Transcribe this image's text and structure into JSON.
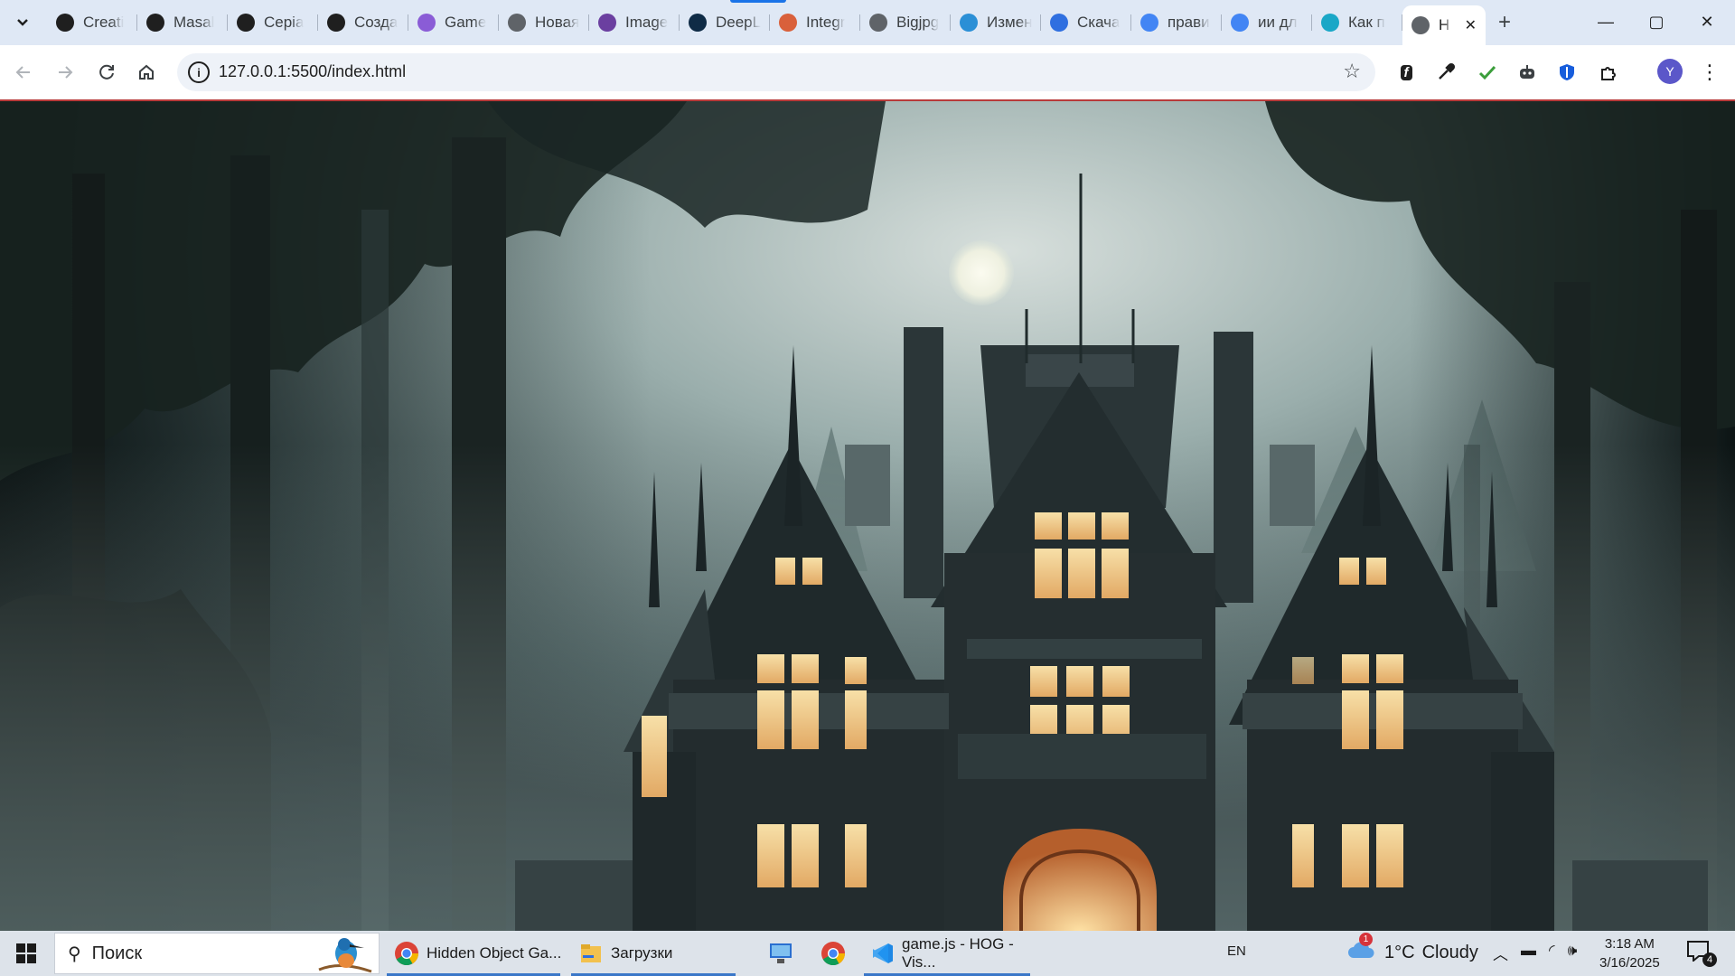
{
  "browser": {
    "tabs": [
      {
        "label": "Creati",
        "icon": "copilot-icon",
        "color": "#1f1f1f"
      },
      {
        "label": "Masal",
        "icon": "github-icon",
        "color": "#1f1f1f"
      },
      {
        "label": "Серіа",
        "icon": "clapperboard-icon",
        "color": "#1f1f1f"
      },
      {
        "label": "Созда",
        "icon": "openai-icon",
        "color": "#1f1f1f"
      },
      {
        "label": "Game",
        "icon": "spiral-icon",
        "color": "#8a5cd6"
      },
      {
        "label": "Новая",
        "icon": "globe-icon",
        "color": "#5f6368"
      },
      {
        "label": "Image",
        "icon": "sail-icon",
        "color": "#6b3fa0"
      },
      {
        "label": "DeepL",
        "icon": "deepl-icon",
        "color": "#0f2b46"
      },
      {
        "label": "Integr",
        "icon": "claude-icon",
        "color": "#d9603b"
      },
      {
        "label": "Bigjpg",
        "icon": "b-letter-icon",
        "color": "#5f6368"
      },
      {
        "label": "Измен",
        "icon": "rp-icon",
        "color": "#2b8fd6"
      },
      {
        "label": "Скача",
        "icon": "cloud-bird-icon",
        "color": "#2f6fe0"
      },
      {
        "label": "прави",
        "icon": "google-icon",
        "color": "#4285f4"
      },
      {
        "label": "ии дл",
        "icon": "google-icon",
        "color": "#4285f4"
      },
      {
        "label": "Как п",
        "icon": "sparkle-icon",
        "color": "#1aa7c7"
      }
    ],
    "active_tab": {
      "label": "H",
      "icon": "globe-icon",
      "close": "✕"
    },
    "new_tab": "+",
    "window": {
      "minimize": "—",
      "maximize": "▢",
      "close": "✕"
    },
    "url": "127.0.0.1:5500/index.html",
    "profile_initial": "Y",
    "extensions": [
      "fontface-icon",
      "eyedropper-icon",
      "leaf-check-icon",
      "robot-icon",
      "shield-icon",
      "puzzle-icon"
    ]
  },
  "scene": {
    "description_visible": "Haunted mansion at night in a foggy forest with full moon",
    "colors": {
      "sky": "#b9c6c4",
      "fog": "#8fa3a2",
      "mansion": "#1c2527",
      "window_glow": "#f3c98a",
      "trees": "#142020"
    }
  },
  "taskbar": {
    "search_placeholder": "Поиск",
    "apps": [
      {
        "label": "Hidden Object Ga...",
        "icon": "chrome-icon",
        "active": true
      },
      {
        "label": "Загрузки",
        "icon": "folder-icon",
        "active": true
      },
      {
        "label": "",
        "icon": "remote-desktop-icon",
        "active": false
      },
      {
        "label": "",
        "icon": "chrome-icon",
        "active": false
      },
      {
        "label": "game.js - HOG - Vis...",
        "icon": "vscode-icon",
        "active": true
      }
    ],
    "language": "EN",
    "weather": {
      "temp": "1°C",
      "condition": "Cloudy",
      "badge": "1"
    },
    "time": "3:18 AM",
    "date": "3/16/2025",
    "notifications": "4"
  }
}
